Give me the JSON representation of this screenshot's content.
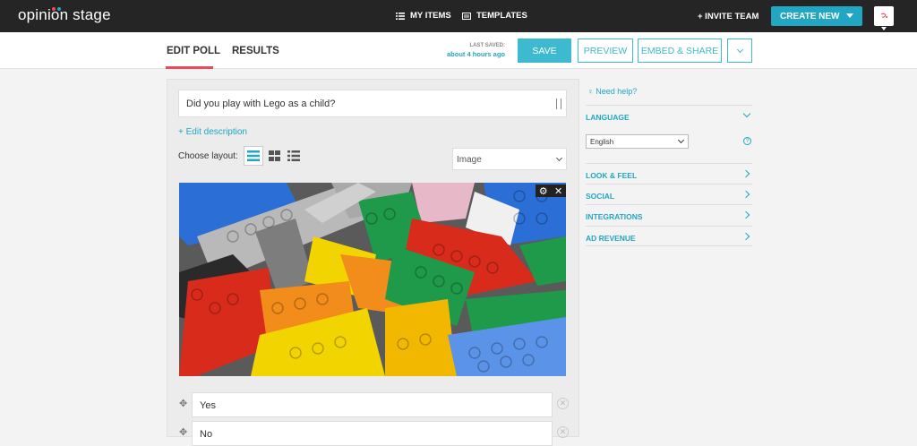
{
  "topbar": {
    "logo": "opinion stage",
    "nav": [
      {
        "label": "MY ITEMS",
        "icon": "list-icon"
      },
      {
        "label": "TEMPLATES",
        "icon": "template-icon"
      }
    ],
    "invite": "+ INVITE TEAM",
    "create": "CREATE NEW"
  },
  "subbar": {
    "tabs": [
      "EDIT POLL",
      "RESULTS"
    ],
    "last_saved_label": "LAST SAVED:",
    "last_saved_time": "about 4 hours ago",
    "save": "SAVE",
    "preview": "PREVIEW",
    "embed": "EMBED & SHARE"
  },
  "editor": {
    "question": "Did you play with Lego as a child?",
    "edit_description": "+ Edit description",
    "layout_label": "Choose layout:",
    "media_select": "Image",
    "answers": [
      "Yes",
      "No"
    ]
  },
  "sidebar": {
    "help": "Need help?",
    "sections": [
      "LANGUAGE",
      "LOOK & FEEL",
      "SOCIAL",
      "INTEGRATIONS",
      "AD REVENUE"
    ],
    "language_value": "English"
  },
  "colors": {
    "accent": "#21a6c3",
    "tab_underline": "#e94b5b",
    "topbar": "#252525"
  }
}
